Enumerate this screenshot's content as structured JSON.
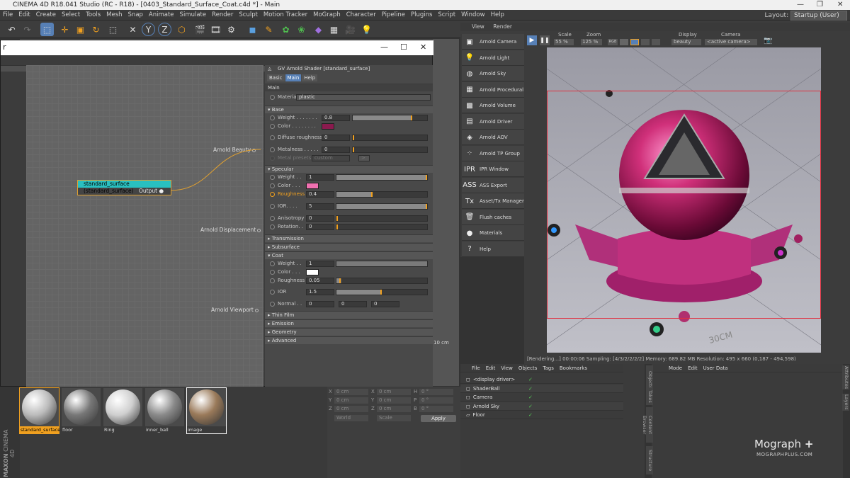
{
  "window": {
    "title": "CINEMA 4D R18.041 Studio (RC - R18) - [0403_Standard_Surface_Coat.c4d *] - Main"
  },
  "menu": [
    "File",
    "Edit",
    "Create",
    "Select",
    "Tools",
    "Mesh",
    "Snap",
    "Animate",
    "Simulate",
    "Render",
    "Sculpt",
    "Motion Tracker",
    "MoGraph",
    "Character",
    "Pipeline",
    "Plugins",
    "Script",
    "Window",
    "Help"
  ],
  "layout": {
    "label": "Layout:",
    "value": "Startup (User)"
  },
  "node_editor": {
    "header": "standard_surface",
    "ports": {
      "beauty": "Arnold Beauty",
      "displacement": "Arnold Displacement",
      "viewport": "Arnold Viewport"
    },
    "node": {
      "title": "standard_surface (standard_surface)",
      "output": "Output"
    }
  },
  "attr": {
    "title": "GV Arnold Shader [standard_surface]",
    "tabs": [
      "Basic",
      "Main",
      "Help"
    ],
    "active_tab": "Main",
    "group": "Main",
    "material_label": "Material",
    "material_value": "plastic",
    "sections": {
      "base": "Base",
      "specular": "Specular",
      "transmission": "Transmission",
      "subsurface": "Subsurface",
      "coat": "Coat",
      "thinfilm": "Thin Film",
      "emission": "Emission",
      "geometry": "Geometry",
      "advanced": "Advanced"
    },
    "base": {
      "weight_label": "Weight . . . . . . .",
      "weight": "0.8",
      "weight_frac": 0.8,
      "color_label": "Color . . . . . . . .",
      "color": "#8a1a4e",
      "diffuse_label": "Diffuse roughness",
      "diffuse": "0",
      "metal_label": "Metalness . . . . .",
      "metal": "0",
      "presets_label": "Metal presets",
      "presets_value": "custom",
      "presets_btn": ">"
    },
    "spec": {
      "weight_label": "Weight . .",
      "weight": "1",
      "weight_frac": 1.0,
      "color_label": "Color . . .",
      "color": "#f070b0",
      "rough_label": "Roughness",
      "rough": "0.4",
      "rough_frac": 0.4,
      "ior_label": "IOR. . . .",
      "ior": "5",
      "ior_frac": 1.0,
      "aniso_label": "Anisotropy",
      "aniso": "0",
      "rot_label": "Rotation. .",
      "rot": "0"
    },
    "coat": {
      "weight_label": "Weight . .",
      "weight": "1",
      "color_label": "Color . . .",
      "color": "#ffffff",
      "rough_label": "Roughness",
      "rough": "0.05",
      "rough_frac": 0.05,
      "ior_label": "IOR",
      "ior": "1.5",
      "ior_frac": 0.5,
      "normal_label": "Normal . .",
      "n1": "0",
      "n2": "0",
      "n3": "0"
    }
  },
  "materials": [
    {
      "name": "standard_surface",
      "color": "#bbbbbb"
    },
    {
      "name": "floor",
      "color": "#777777"
    },
    {
      "name": "Ring",
      "color": "#cfcfcf"
    },
    {
      "name": "inner_ball",
      "color": "#8a8a8a"
    },
    {
      "name": "image",
      "color": "#9a7a5a"
    }
  ],
  "coords": {
    "rows": [
      {
        "axis": "X",
        "v1": "0 cm",
        "a2": "X",
        "v2": "0 cm",
        "a3": "H",
        "v3": "0 °"
      },
      {
        "axis": "Y",
        "v1": "0 cm",
        "a2": "Y",
        "v2": "0 cm",
        "a3": "P",
        "v3": "0 °"
      },
      {
        "axis": "Z",
        "v1": "0 cm",
        "a2": "Z",
        "v2": "0 cm",
        "a3": "B",
        "v3": "0 °"
      }
    ],
    "mode": "World",
    "scale": "Scale",
    "apply": "Apply"
  },
  "arnold_menu": [
    "Arnold Camera",
    "Arnold Light",
    "Arnold Sky",
    "Arnold Procedural",
    "Arnold Volume",
    "Arnold Driver",
    "Arnold AOV",
    "Arnold TP Group",
    "IPR Window",
    "ASS Export",
    "Asset/Tx Manager",
    "Flush caches",
    "Materials",
    "Help"
  ],
  "arnold_icons": [
    "camera-icon",
    "bulb-icon",
    "globe-icon",
    "cube-icon",
    "volume-icon",
    "document-icon",
    "layers-icon",
    "dots-icon",
    "ipr-icon",
    "ass-icon",
    "tx-icon",
    "trash-icon",
    "sphere-icon",
    "question-icon"
  ],
  "arnold_glyphs": [
    "▣",
    "💡",
    "◍",
    "▦",
    "▩",
    "▤",
    "◈",
    "⁘",
    "IPR",
    "ASS",
    "Tx",
    "🗑",
    "●",
    "?"
  ],
  "irv": {
    "menu": [
      "View",
      "Render"
    ],
    "scale_label": "Scale",
    "scale": "55 %",
    "zoom_label": "Zoom",
    "zoom": "125 %",
    "display_label": "Display",
    "display": "beauty",
    "camera_label": "Camera",
    "camera": "<active camera>",
    "rgb": "RGB",
    "status": "[Rendering...] 00:00:06  Sampling: [4/3/2/2/2/2]  Memory: 689.82 MB  Resolution: 495 x 660 (0,187 - 494,598)",
    "scene": "10 cm"
  },
  "objects": {
    "menu": [
      "File",
      "Edit",
      "View",
      "Objects",
      "Tags",
      "Bookmarks"
    ],
    "items": [
      "<display driver>",
      "ShaderBall",
      "Camera",
      "Arnold Sky",
      "Floor"
    ]
  },
  "attrmgr": {
    "menu": [
      "Mode",
      "Edit",
      "User Data"
    ]
  },
  "side_tabs": [
    "Objects",
    "Takes",
    "Content Browser",
    "Structure",
    "Attributes",
    "Layers"
  ],
  "brand": {
    "name": "Mograph",
    "plus": "+",
    "site": "MOGRAPHPLUS.COM",
    "maxon": "MAXON",
    "c4d": "CINEMA 4D"
  }
}
